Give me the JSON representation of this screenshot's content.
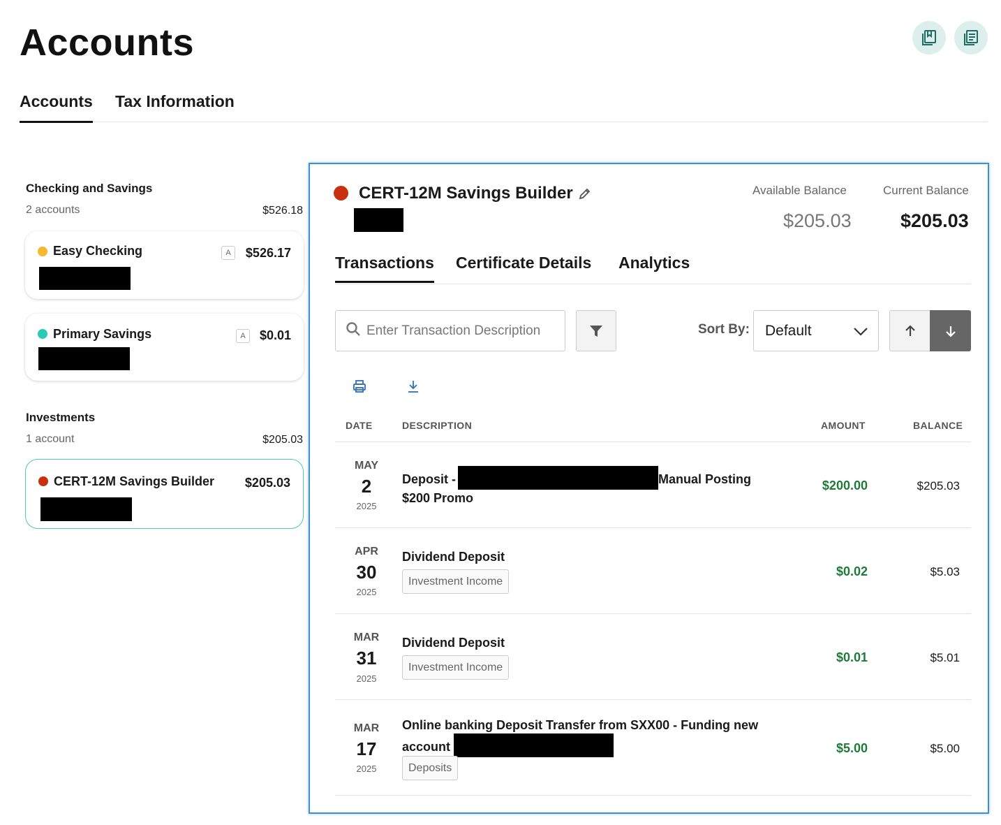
{
  "page": {
    "title": "Accounts"
  },
  "header_actions": [
    {
      "name": "statements-icon"
    },
    {
      "name": "documents-icon"
    }
  ],
  "main_tabs": [
    {
      "label": "Accounts",
      "active": true
    },
    {
      "label": "Tax Information",
      "active": false
    }
  ],
  "groups": [
    {
      "title": "Checking and Savings",
      "count": "2 accounts",
      "total": "$526.18",
      "accounts": [
        {
          "name": "Easy Checking",
          "badge": "A",
          "balance": "$526.17",
          "color": "#f5b82e"
        },
        {
          "name": "Primary Savings",
          "badge": "A",
          "balance": "$0.01",
          "color": "#2cc9b5"
        }
      ]
    },
    {
      "title": "Investments",
      "count": "1 account",
      "total": "$205.03",
      "accounts": [
        {
          "name": "CERT-12M Savings Builder",
          "balance": "$205.03",
          "color": "#c8300f",
          "selected": true
        }
      ]
    }
  ],
  "detail": {
    "name": "CERT-12M Savings Builder",
    "color": "#c8300f",
    "available_label": "Available Balance",
    "available_value": "$205.03",
    "current_label": "Current Balance",
    "current_value": "$205.03",
    "tabs": [
      {
        "label": "Transactions",
        "active": true
      },
      {
        "label": "Certificate Details",
        "active": false
      },
      {
        "label": "Analytics",
        "active": false
      }
    ],
    "search": {
      "placeholder": "Enter Transaction Description",
      "value": ""
    },
    "sort": {
      "label": "Sort By:",
      "value": "Default"
    },
    "table": {
      "headers": {
        "date": "DATE",
        "description": "DESCRIPTION",
        "amount": "AMOUNT",
        "balance": "BALANCE"
      },
      "rows": [
        {
          "month": "MAY",
          "day": "2",
          "year": "2025",
          "desc_line1_a": "Deposit -",
          "desc_line1_b": "Manual Posting",
          "desc_line2": "$200 Promo",
          "tag": "",
          "amount": "$200.00",
          "balance": "$205.03"
        },
        {
          "month": "APR",
          "day": "30",
          "year": "2025",
          "desc_line1_a": "Dividend Deposit",
          "desc_line1_b": "",
          "desc_line2": "",
          "tag": "Investment Income",
          "amount": "$0.02",
          "balance": "$5.03"
        },
        {
          "month": "MAR",
          "day": "31",
          "year": "2025",
          "desc_line1_a": "Dividend Deposit",
          "desc_line1_b": "",
          "desc_line2": "",
          "tag": "Investment Income",
          "amount": "$0.01",
          "balance": "$5.01"
        },
        {
          "month": "MAR",
          "day": "17",
          "year": "2025",
          "desc_line1_a": "Online banking Deposit Transfer from SXX00 - Funding new",
          "desc_line1_b": "",
          "desc_line2": "account",
          "tag": "Deposits",
          "amount": "$5.00",
          "balance": "$5.00"
        }
      ]
    }
  }
}
